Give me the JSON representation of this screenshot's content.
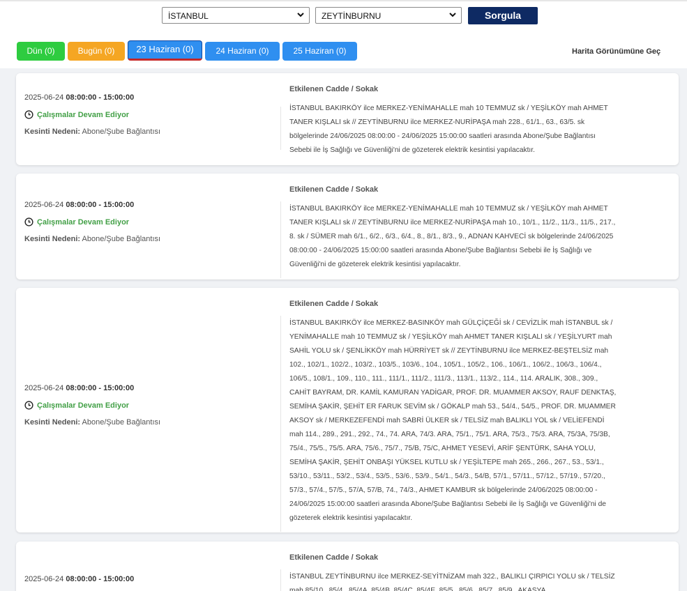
{
  "filters": {
    "city": "İSTANBUL",
    "district": "ZEYTİNBURNU",
    "query_button": "Sorgula"
  },
  "tabs": [
    {
      "label": "Dün (0)",
      "color": "#2ecc40"
    },
    {
      "label": "Bugün (0)",
      "color": "#f5a623"
    },
    {
      "label": "23 Haziran (0)",
      "color": "#2f8ff0"
    },
    {
      "label": "24 Haziran (0)",
      "color": "#2f8ff0"
    },
    {
      "label": "25 Haziran (0)",
      "color": "#2f8ff0"
    }
  ],
  "map_link": "Harita Görünümüne Geç",
  "labels": {
    "affected": "Etkilenen Cadde / Sokak",
    "reason": "Kesinti Nedeni:"
  },
  "outages": [
    {
      "date": "2025-06-24",
      "time": "08:00:00 - 15:00:00",
      "status": "Çalışmalar Devam Ediyor",
      "reason": "Abone/Şube Bağlantısı",
      "streets": "İSTANBUL BAKIRKÖY ilce MERKEZ-YENİMAHALLE mah 10 TEMMUZ sk / YEŞİLKÖY mah AHMET TANER KIŞLALI sk // ZEYTİNBURNU ilce MERKEZ-NURİPAŞA mah 228., 61/1., 63., 63/5. sk bölgelerinde 24/06/2025 08:00:00 - 24/06/2025 15:00:00 saatleri arasında Abone/Şube Bağlantısı Sebebi ile İş Sağlığı ve Güvenliği'ni de gözeterek elektrik kesintisi yapılacaktır."
    },
    {
      "date": "2025-06-24",
      "time": "08:00:00 - 15:00:00",
      "status": "Çalışmalar Devam Ediyor",
      "reason": "Abone/Şube Bağlantısı",
      "streets": "İSTANBUL BAKIRKÖY ilce MERKEZ-YENİMAHALLE mah 10 TEMMUZ sk / YEŞİLKÖY mah AHMET TANER KIŞLALI sk // ZEYTİNBURNU ilce MERKEZ-NURİPAŞA mah 10., 10/1., 11/2., 11/3., 11/5., 217., 8. sk / SÜMER mah 6/1., 6/2., 6/3., 6/4., 8., 8/1., 8/3., 9., ADNAN KAHVECİ sk bölgelerinde 24/06/2025 08:00:00 - 24/06/2025 15:00:00 saatleri arasında Abone/Şube Bağlantısı Sebebi ile İş Sağlığı ve Güvenliği'ni de gözeterek elektrik kesintisi yapılacaktır."
    },
    {
      "date": "2025-06-24",
      "time": "08:00:00 - 15:00:00",
      "status": "Çalışmalar Devam Ediyor",
      "reason": "Abone/Şube Bağlantısı",
      "streets": "İSTANBUL BAKIRKÖY ilce MERKEZ-BASINKÖY mah GÜLÇİÇEĞİ sk / CEVİZLİK mah İSTANBUL sk / YENİMAHALLE mah 10 TEMMUZ sk / YEŞİLKÖY mah AHMET TANER KIŞLALI sk / YEŞİLYURT mah SAHİL YOLU sk / ŞENLİKKÖY mah HÜRRİYET sk // ZEYTİNBURNU ilce MERKEZ-BEŞTELSİZ mah 102., 102/1., 102/2., 103/2., 103/5., 103/6., 104., 105/1., 105/2., 106., 106/1., 106/2., 106/3., 106/4., 106/5., 108/1., 109., 110., 111., 111/1., 111/2., 111/3., 113/1., 113/2., 114., 114. ARALIK, 308., 309., CAHİT BAYRAM, DR. KAMİL KAMURAN YADİGAR, PROF. DR. MUAMMER AKSOY, RAUF DENKTAŞ, SEMİHA ŞAKİR, ŞEHİT ER FARUK SEVİM sk / GÖKALP mah 53., 54/4., 54/5., PROF. DR. MUAMMER AKSOY sk / MERKEZEFENDİ mah SABRİ ÜLKER sk / TELSİZ mah BALIKLI YOL sk / VELİEFENDİ mah 114., 289., 291., 292., 74., 74. ARA, 74/3. ARA, 75/1., 75/1. ARA, 75/3., 75/3. ARA, 75/3A, 75/3B, 75/4., 75/5., 75/5. ARA, 75/6., 75/7., 75/B, 75/C, AHMET YESEVİ, ARİF ŞENTÜRK, SAHA YOLU, SEMİHA ŞAKİR, ŞEHİT ONBAŞI YÜKSEL KUTLU sk / YEŞİLTEPE mah 265., 266., 267., 53., 53/1., 53/10., 53/11., 53/2., 53/4., 53/5., 53/6., 53/9., 54/1., 54/3., 54/B, 57/1., 57/11., 57/12., 57/19., 57/20., 57/3., 57/4., 57/5., 57/A, 57/B, 74., 74/3., AHMET KAMBUR sk bölgelerinde 24/06/2025 08:00:00 - 24/06/2025 15:00:00 saatleri arasında Abone/Şube Bağlantısı Sebebi ile İş Sağlığı ve Güvenliği'ni de gözeterek elektrik kesintisi yapılacaktır."
    },
    {
      "date": "2025-06-24",
      "time": "08:00:00 - 15:00:00",
      "status": "",
      "reason": "",
      "streets": "İSTANBUL ZEYTİNBURNU ilce MERKEZ-SEYİTNİZAM mah 322., BALIKLI ÇIRPICI YOLU sk / TELSİZ mah 85/10., 85/4., 85/4A, 85/4B, 85/4C, 85/4E, 85/5., 85/6., 85/7., 85/9., AKASYA"
    }
  ]
}
